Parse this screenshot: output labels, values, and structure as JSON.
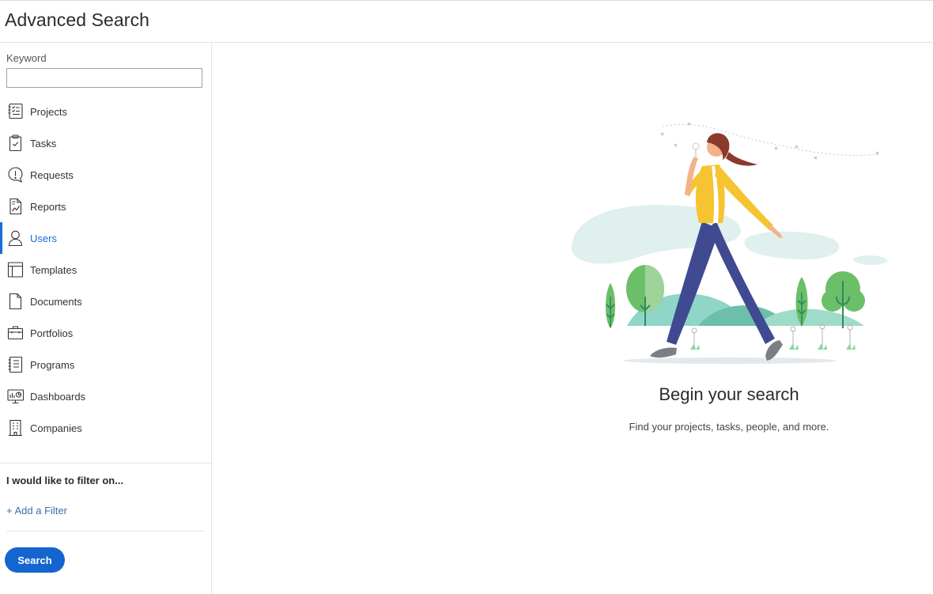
{
  "header": {
    "title": "Advanced Search"
  },
  "sidebar": {
    "keyword_label": "Keyword",
    "keyword_value": "",
    "keyword_placeholder": "",
    "items": [
      {
        "label": "Projects",
        "icon": "projects-icon",
        "active": false
      },
      {
        "label": "Tasks",
        "icon": "clipboard-check-icon",
        "active": false
      },
      {
        "label": "Requests",
        "icon": "speech-bubble-exclamation-icon",
        "active": false
      },
      {
        "label": "Reports",
        "icon": "report-chart-icon",
        "active": false
      },
      {
        "label": "Users",
        "icon": "user-icon",
        "active": true
      },
      {
        "label": "Templates",
        "icon": "template-layout-icon",
        "active": false
      },
      {
        "label": "Documents",
        "icon": "document-icon",
        "active": false
      },
      {
        "label": "Portfolios",
        "icon": "briefcase-icon",
        "active": false
      },
      {
        "label": "Programs",
        "icon": "notebook-list-icon",
        "active": false
      },
      {
        "label": "Dashboards",
        "icon": "dashboard-monitor-icon",
        "active": false
      },
      {
        "label": "Companies",
        "icon": "building-icon",
        "active": false
      }
    ],
    "filter_heading": "I would like to filter on...",
    "add_filter_label": "+ Add a Filter",
    "search_button_label": "Search"
  },
  "main": {
    "title": "Begin your search",
    "subtitle": "Find your projects, tasks, people, and more."
  },
  "colors": {
    "accent": "#1a6cd6",
    "button": "#1565d0",
    "link": "#3d6ea8"
  }
}
